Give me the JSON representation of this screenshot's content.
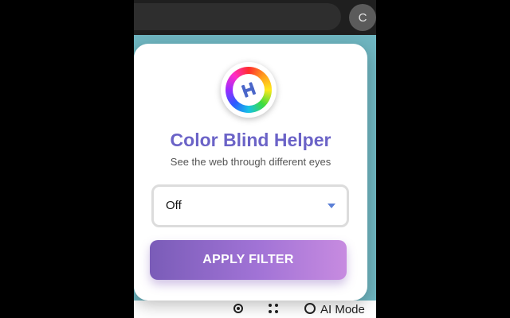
{
  "browser": {
    "profile_initial": "C"
  },
  "page_strip": {
    "search_label": "AI Mode"
  },
  "popup": {
    "title": "Color Blind Helper",
    "subtitle": "See the web through different eyes",
    "logo_letter": "H",
    "filter_select": {
      "selected": "Off"
    },
    "apply_button": "APPLY FILTER"
  },
  "colors": {
    "title": "#6b63c7",
    "button_gradient_start": "#7a5cb8",
    "button_gradient_end": "#c78be0",
    "page_background": "#6fb6c1"
  }
}
